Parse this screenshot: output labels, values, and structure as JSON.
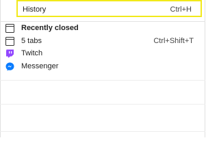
{
  "history": {
    "label": "History",
    "shortcut": "Ctrl+H"
  },
  "recently_closed": {
    "header": "Recently closed",
    "items": [
      {
        "label": "5 tabs",
        "shortcut": "Ctrl+Shift+T",
        "icon": "window-icon"
      },
      {
        "label": "Twitch",
        "shortcut": "",
        "icon": "twitch-icon"
      },
      {
        "label": "Messenger",
        "shortcut": "",
        "icon": "messenger-icon"
      }
    ]
  },
  "colors": {
    "highlight_border": "#f2e91a",
    "twitch": "#9146ff",
    "messenger": "#0a7cff"
  }
}
